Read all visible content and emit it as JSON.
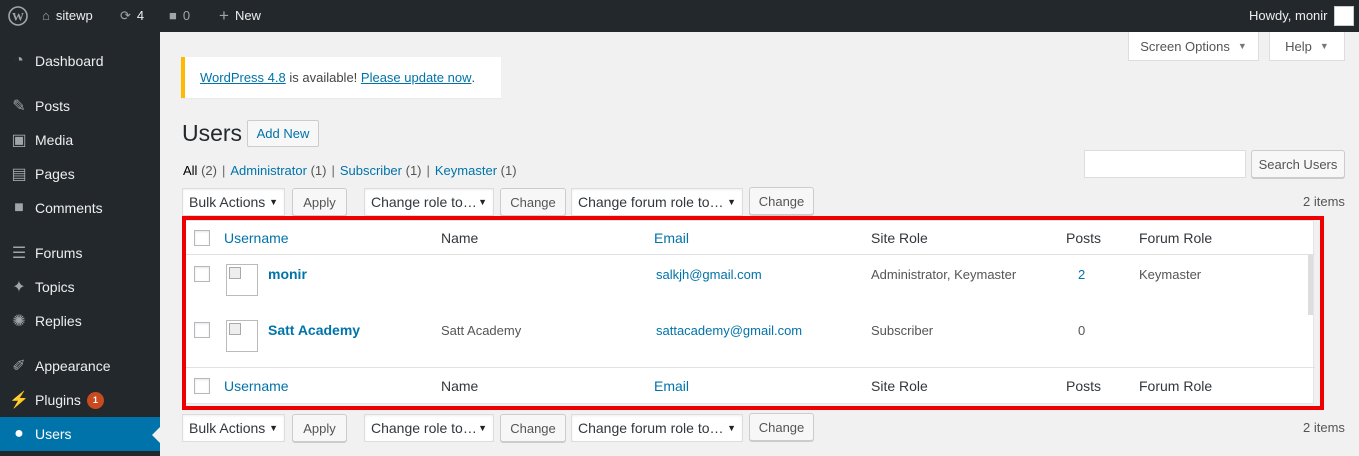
{
  "adminbar": {
    "site": "sitewp",
    "updates": "4",
    "comments": "0",
    "new": "New",
    "howdy": "Howdy, monir"
  },
  "sidebar": {
    "items": [
      {
        "label": "Dashboard",
        "icon": "dashboard-icon"
      },
      {
        "label": "Posts",
        "icon": "pin-icon"
      },
      {
        "label": "Media",
        "icon": "media-icon"
      },
      {
        "label": "Pages",
        "icon": "pages-icon"
      },
      {
        "label": "Comments",
        "icon": "comment-icon"
      },
      {
        "label": "Forums",
        "icon": "forums-icon"
      },
      {
        "label": "Topics",
        "icon": "topics-icon"
      },
      {
        "label": "Replies",
        "icon": "replies-icon"
      },
      {
        "label": "Appearance",
        "icon": "brush-icon"
      },
      {
        "label": "Plugins",
        "icon": "plugin-icon",
        "badge": "1"
      },
      {
        "label": "Users",
        "icon": "user-icon"
      }
    ]
  },
  "tabs": {
    "screen_options": "Screen Options",
    "help": "Help"
  },
  "notice": {
    "version_link": "WordPress 4.8",
    "middle": " is available! ",
    "update_link": "Please update now",
    "end": "."
  },
  "page": {
    "title": "Users",
    "add_new": "Add New"
  },
  "filters": {
    "all": "All",
    "all_count": "(2)",
    "administrator": "Administrator",
    "administrator_count": "(1)",
    "subscriber": "Subscriber",
    "subscriber_count": "(1)",
    "keymaster": "Keymaster",
    "keymaster_count": "(1)"
  },
  "search": {
    "button": "Search Users"
  },
  "tablenav": {
    "bulk_actions": "Bulk Actions",
    "apply": "Apply",
    "change_role": "Change role to…",
    "change": "Change",
    "change_forum_role": "Change forum role to…",
    "items": "2 items"
  },
  "table": {
    "columns": [
      "Username",
      "Name",
      "Email",
      "Site Role",
      "Posts",
      "Forum Role"
    ],
    "rows": [
      {
        "username": "monir",
        "name": "",
        "email": "salkjh@gmail.com",
        "site_role": "Administrator, Keymaster",
        "posts": "2",
        "forum_role": "Keymaster"
      },
      {
        "username": "Satt Academy",
        "name": "Satt Academy",
        "email": "sattacademy@gmail.com",
        "site_role": "Subscriber",
        "posts": "0",
        "forum_role": ""
      }
    ]
  },
  "colors": {
    "admin_dark": "#23282d",
    "accent": "#0073aa",
    "highlight": "#e00000",
    "notice": "#ffb900"
  }
}
